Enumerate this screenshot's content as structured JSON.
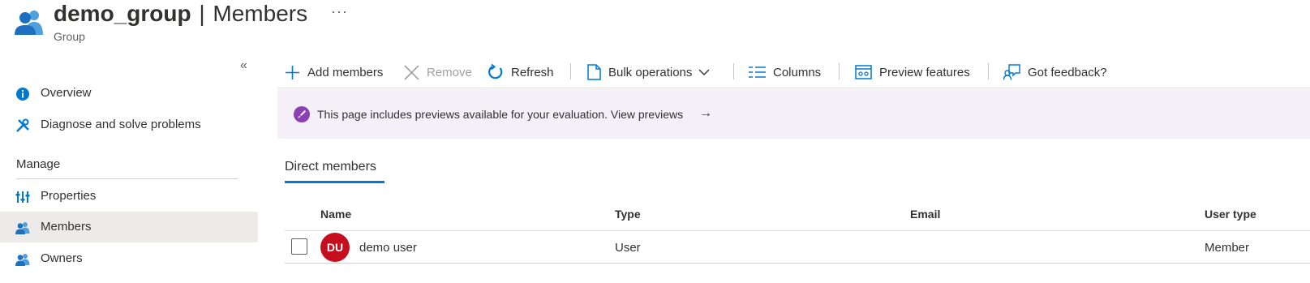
{
  "header": {
    "group_name": "demo_group",
    "separator": "|",
    "section": "Members",
    "more_label": "···",
    "subtitle": "Group",
    "icon": "group-icon"
  },
  "sidebar": {
    "collapse_label": "«",
    "items": [
      {
        "label": "Overview",
        "icon": "info-icon"
      },
      {
        "label": "Diagnose and solve problems",
        "icon": "wrench-icon"
      }
    ],
    "manage_heading": "Manage",
    "manage_items": [
      {
        "label": "Properties",
        "icon": "properties-icon"
      },
      {
        "label": "Members",
        "icon": "members-icon",
        "active": true
      },
      {
        "label": "Owners",
        "icon": "owners-icon"
      }
    ]
  },
  "toolbar": {
    "add_members": "Add members",
    "remove": "Remove",
    "refresh": "Refresh",
    "bulk_operations": "Bulk operations",
    "columns": "Columns",
    "preview_features": "Preview features",
    "got_feedback": "Got feedback?"
  },
  "banner": {
    "text": "This page includes previews available for your evaluation. View previews",
    "arrow": "→",
    "icon": "rocket-icon"
  },
  "tabs": {
    "direct_members": "Direct members"
  },
  "table": {
    "columns": [
      "Name",
      "Type",
      "Email",
      "User type"
    ],
    "rows": [
      {
        "initials": "DU",
        "name": "demo user",
        "type": "User",
        "email": "",
        "user_type": "Member"
      }
    ]
  },
  "colors": {
    "accent": "#0078d4",
    "avatar": "#c50f1f",
    "banner_bg": "#f5eff8",
    "active_nav_bg": "#edebe9",
    "preview_purple": "#8a3fb5"
  }
}
